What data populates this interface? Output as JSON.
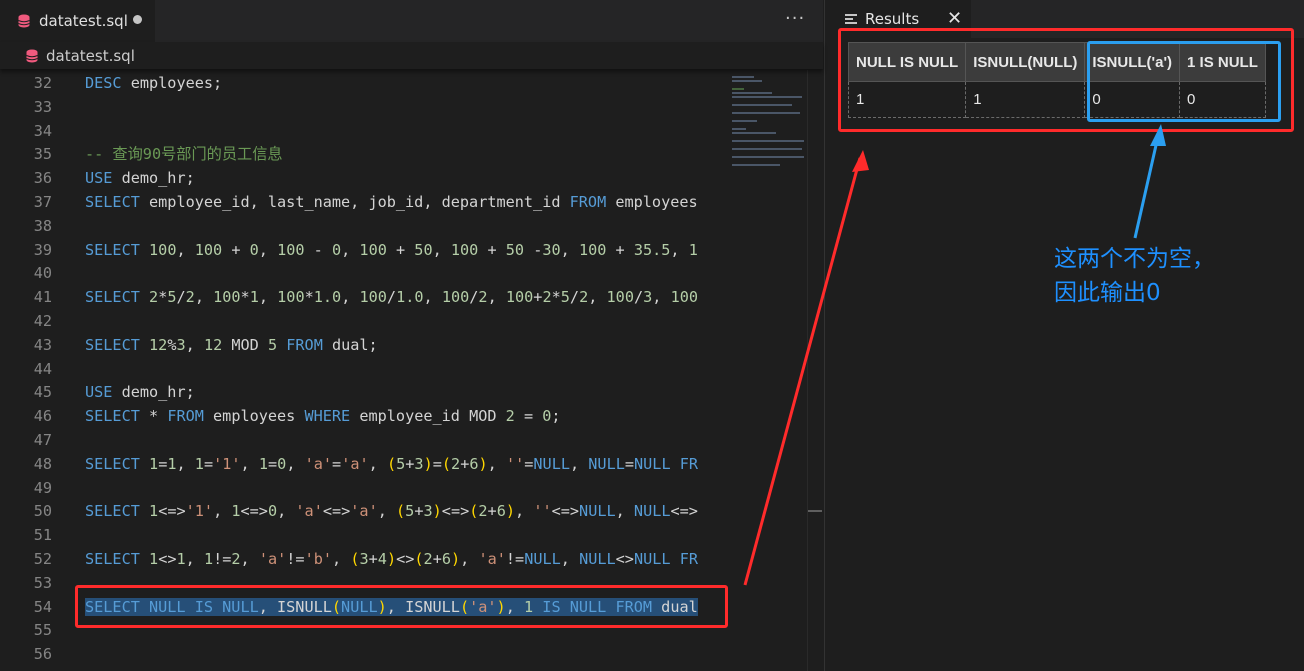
{
  "editor": {
    "tab_label": "datatest.sql",
    "breadcrumb_label": "datatest.sql",
    "more_label": "···",
    "lines": [
      {
        "n": "32",
        "html": "<span class=\"kw\">DESC</span> employees;"
      },
      {
        "n": "33",
        "html": ""
      },
      {
        "n": "34",
        "html": ""
      },
      {
        "n": "35",
        "html": "<span class=\"cm\">-- 查询90号部门的员工信息</span>"
      },
      {
        "n": "36",
        "html": "<span class=\"kw\">USE</span> demo_hr;"
      },
      {
        "n": "37",
        "html": "<span class=\"kw\">SELECT</span> employee_id, last_name, job_id, department_id <span class=\"kw\">FROM</span> employees"
      },
      {
        "n": "38",
        "html": ""
      },
      {
        "n": "39",
        "html": "<span class=\"kw\">SELECT</span> <span class=\"num\">100</span>, <span class=\"num\">100</span> + <span class=\"num\">0</span>, <span class=\"num\">100</span> - <span class=\"num\">0</span>, <span class=\"num\">100</span> + <span class=\"num\">50</span>, <span class=\"num\">100</span> + <span class=\"num\">50</span> -<span class=\"num\">30</span>, <span class=\"num\">100</span> + <span class=\"num\">35.5</span>, <span class=\"num\">1</span>"
      },
      {
        "n": "40",
        "html": ""
      },
      {
        "n": "41",
        "html": "<span class=\"kw\">SELECT</span> <span class=\"num\">2</span>*<span class=\"num\">5</span>/<span class=\"num\">2</span>, <span class=\"num\">100</span>*<span class=\"num\">1</span>, <span class=\"num\">100</span>*<span class=\"num\">1.0</span>, <span class=\"num\">100</span>/<span class=\"num\">1.0</span>, <span class=\"num\">100</span>/<span class=\"num\">2</span>, <span class=\"num\">100</span>+<span class=\"num\">2</span>*<span class=\"num\">5</span>/<span class=\"num\">2</span>, <span class=\"num\">100</span>/<span class=\"num\">3</span>, <span class=\"num\">100</span>"
      },
      {
        "n": "42",
        "html": ""
      },
      {
        "n": "43",
        "html": "<span class=\"kw\">SELECT</span> <span class=\"num\">12</span>%<span class=\"num\">3</span>, <span class=\"num\">12</span> MOD <span class=\"num\">5</span> <span class=\"kw\">FROM</span> dual;"
      },
      {
        "n": "44",
        "html": ""
      },
      {
        "n": "45",
        "html": "<span class=\"kw\">USE</span> demo_hr;"
      },
      {
        "n": "46",
        "html": "<span class=\"kw\">SELECT</span> * <span class=\"kw\">FROM</span> employees <span class=\"kw\">WHERE</span> employee_id MOD <span class=\"num\">2</span> = <span class=\"num\">0</span>;"
      },
      {
        "n": "47",
        "html": ""
      },
      {
        "n": "48",
        "html": "<span class=\"kw\">SELECT</span> <span class=\"num\">1</span>=<span class=\"num\">1</span>, <span class=\"num\">1</span>=<span class=\"str\">'1'</span>, <span class=\"num\">1</span>=<span class=\"num\">0</span>, <span class=\"str\">'a'</span>=<span class=\"str\">'a'</span>, <span class=\"br1\">(</span><span class=\"num\">5</span>+<span class=\"num\">3</span><span class=\"br1\">)</span>=<span class=\"br1\">(</span><span class=\"num\">2</span>+<span class=\"num\">6</span><span class=\"br1\">)</span>, <span class=\"str\">''</span>=<span class=\"kw\">NULL</span>, <span class=\"kw\">NULL</span>=<span class=\"kw\">NULL</span> <span class=\"kw\">FR</span>"
      },
      {
        "n": "49",
        "html": ""
      },
      {
        "n": "50",
        "html": "<span class=\"kw\">SELECT</span> <span class=\"num\">1</span>&lt;=&gt;<span class=\"str\">'1'</span>, <span class=\"num\">1</span>&lt;=&gt;<span class=\"num\">0</span>, <span class=\"str\">'a'</span>&lt;=&gt;<span class=\"str\">'a'</span>, <span class=\"br1\">(</span><span class=\"num\">5</span>+<span class=\"num\">3</span><span class=\"br1\">)</span>&lt;=&gt;<span class=\"br1\">(</span><span class=\"num\">2</span>+<span class=\"num\">6</span><span class=\"br1\">)</span>, <span class=\"str\">''</span>&lt;=&gt;<span class=\"kw\">NULL</span>, <span class=\"kw\">NULL</span>&lt;=&gt;"
      },
      {
        "n": "51",
        "html": ""
      },
      {
        "n": "52",
        "html": "<span class=\"kw\">SELECT</span> <span class=\"num\">1</span>&lt;&gt;<span class=\"num\">1</span>, <span class=\"num\">1</span>!=<span class=\"num\">2</span>, <span class=\"str\">'a'</span>!=<span class=\"str\">'b'</span>, <span class=\"br1\">(</span><span class=\"num\">3</span>+<span class=\"num\">4</span><span class=\"br1\">)</span>&lt;&gt;<span class=\"br1\">(</span><span class=\"num\">2</span>+<span class=\"num\">6</span><span class=\"br1\">)</span>, <span class=\"str\">'a'</span>!=<span class=\"kw\">NULL</span>, <span class=\"kw\">NULL</span>&lt;&gt;<span class=\"kw\">NULL</span> <span class=\"kw\">FR</span>"
      },
      {
        "n": "53",
        "html": ""
      },
      {
        "n": "54",
        "html": "<span class=\"selbg\"><span class=\"kw\">SELECT NULL IS NULL</span>, ISNULL<span class=\"br1\">(</span><span class=\"kw\">NULL</span><span class=\"br1\">)</span>, ISNULL<span class=\"br1\">(</span><span class=\"str\">'a'</span><span class=\"br1\">)</span>, <span class=\"num\">1</span> <span class=\"kw\">IS NULL FROM</span> dual</span>"
      },
      {
        "n": "55",
        "html": ""
      },
      {
        "n": "56",
        "html": ""
      }
    ]
  },
  "results": {
    "tab_label": "Results",
    "close_label": "✕",
    "columns": [
      "NULL IS NULL",
      "ISNULL(NULL)",
      "ISNULL('a')",
      "1 IS NULL"
    ],
    "rows": [
      [
        "1",
        "1",
        "0",
        "0"
      ]
    ]
  },
  "annotation": {
    "text": "这两个不为空，\n因此输出0"
  },
  "colors": {
    "red_annotation": "#ff2b2b",
    "blue_annotation": "#2b9ff0",
    "keyword": "#569cd6",
    "comment": "#6a9955"
  }
}
